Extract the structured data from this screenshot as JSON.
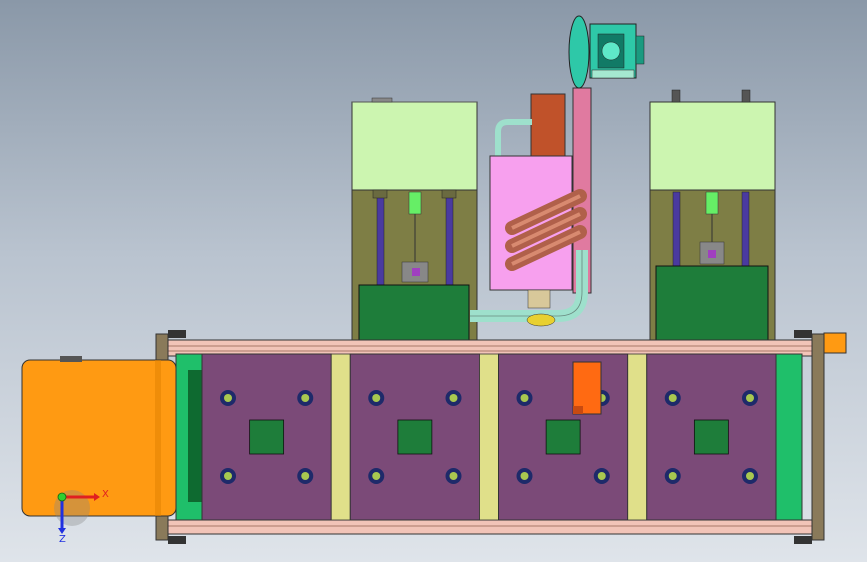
{
  "view": {
    "type": "cad-assembly-front-view",
    "colors": {
      "background_top": "#8a98a8",
      "background_bottom": "#dfe4ea",
      "tank_top": "#ccf5b0",
      "tank_body": "#7e7e45",
      "base_block": "#1e7d3a",
      "heater_box": "#f7a0ee",
      "motor_block": "#c0522a",
      "pipe": "#9ee0cc",
      "frame_rail": "#f2c4b8",
      "frame_post": "#8a7a5a",
      "platen": "#7b4a78",
      "spacer": "#e0e08a",
      "end_block": "#1fbf6a",
      "cabinet": "#ff9a12",
      "fan": "#2ec8a8",
      "exhaust_pipe": "#b0604a",
      "hole_outer": "#1e2a6a",
      "hole_inner": "#a8c850"
    },
    "platen_count": 4
  },
  "triad": {
    "x_label": "X",
    "y_label": "Y",
    "z_label": "Z"
  }
}
